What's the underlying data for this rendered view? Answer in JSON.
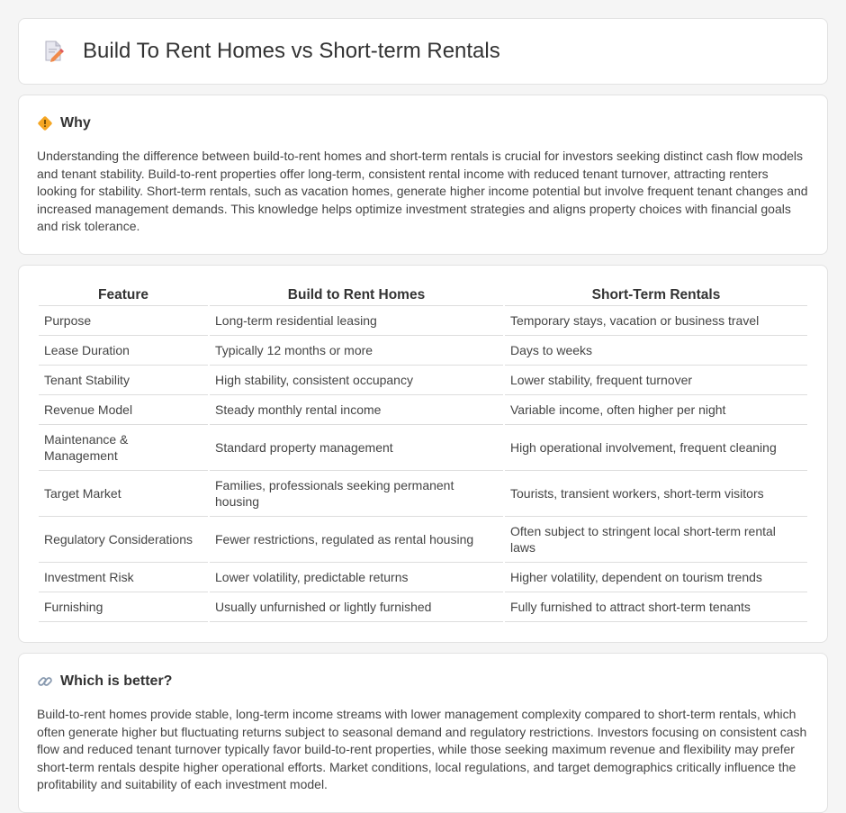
{
  "header": {
    "title": "Build To Rent Homes vs Short-term Rentals",
    "icon": "document-pencil-icon"
  },
  "why": {
    "title": "Why",
    "icon": "road-sign-icon",
    "text": "Understanding the difference between build-to-rent homes and short-term rentals is crucial for investors seeking distinct cash flow models and tenant stability. Build-to-rent properties offer long-term, consistent rental income with reduced tenant turnover, attracting renters looking for stability. Short-term rentals, such as vacation homes, generate higher income potential but involve frequent tenant changes and increased management demands. This knowledge helps optimize investment strategies and aligns property choices with financial goals and risk tolerance."
  },
  "table": {
    "headers": [
      "Feature",
      "Build to Rent Homes",
      "Short-Term Rentals"
    ],
    "rows": [
      [
        "Purpose",
        "Long-term residential leasing",
        "Temporary stays, vacation or business travel"
      ],
      [
        "Lease Duration",
        "Typically 12 months or more",
        "Days to weeks"
      ],
      [
        "Tenant Stability",
        "High stability, consistent occupancy",
        "Lower stability, frequent turnover"
      ],
      [
        "Revenue Model",
        "Steady monthly rental income",
        "Variable income, often higher per night"
      ],
      [
        "Maintenance & Management",
        "Standard property management",
        "High operational involvement, frequent cleaning"
      ],
      [
        "Target Market",
        "Families, professionals seeking permanent housing",
        "Tourists, transient workers, short-term visitors"
      ],
      [
        "Regulatory Considerations",
        "Fewer restrictions, regulated as rental housing",
        "Often subject to stringent local short-term rental laws"
      ],
      [
        "Investment Risk",
        "Lower volatility, predictable returns",
        "Higher volatility, dependent on tourism trends"
      ],
      [
        "Furnishing",
        "Usually unfurnished or lightly furnished",
        "Fully furnished to attract short-term tenants"
      ]
    ]
  },
  "better": {
    "title": "Which is better?",
    "icon": "link-icon",
    "text": "Build-to-rent homes provide stable, long-term income streams with lower management complexity compared to short-term rentals, which often generate higher but fluctuating returns subject to seasonal demand and regulatory restrictions. Investors focusing on consistent cash flow and reduced tenant turnover typically favor build-to-rent properties, while those seeking maximum revenue and flexibility may prefer short-term rentals despite higher operational efforts. Market conditions, local regulations, and target demographics critically influence the profitability and suitability of each investment model."
  }
}
